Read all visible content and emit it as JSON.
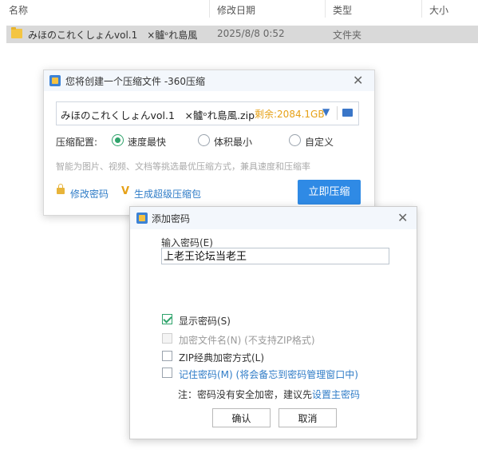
{
  "explorer": {
    "columns": {
      "name": "名称",
      "modified": "修改日期",
      "type": "类型",
      "size": "大小"
    },
    "rows": [
      {
        "name": "みほのこれくしょんvol.1　×髗ᵒれ島風",
        "modified": "2025/8/8 0:52",
        "type": "文件夹"
      }
    ]
  },
  "compress_dialog": {
    "title": "您将创建一个压缩文件 -360压缩",
    "file_name": "みほのこれくしょんvol.1　×髗ᵒれ島風.zip",
    "remaining": "剩余:2084.1GB",
    "config_label": "压缩配置:",
    "options": [
      {
        "label": "速度最快",
        "selected": true
      },
      {
        "label": "体积最小",
        "selected": false
      },
      {
        "label": "自定义",
        "selected": false
      }
    ],
    "hint": "智能为图片、视频、文档等挑选最优压缩方式，兼具速度和压缩率",
    "modify_password": "修改密码",
    "super_compress": "生成超级压缩包",
    "compress_now": "立即压缩"
  },
  "password_dialog": {
    "title": "添加密码",
    "input_label": "输入密码(E)",
    "password_value": "上老王论坛当老王",
    "checkboxes": [
      {
        "label": "显示密码(S)",
        "checked": true,
        "disabled": false,
        "link": false
      },
      {
        "label": "加密文件名(N) (不支持ZIP格式)",
        "checked": false,
        "disabled": true,
        "link": false
      },
      {
        "label": "ZIP经典加密方式(L)",
        "checked": false,
        "disabled": false,
        "link": false
      },
      {
        "label": "记住密码(M) (将会备忘到密码管理窗口中)",
        "checked": false,
        "disabled": false,
        "link": true
      }
    ],
    "note_prefix": "注：密码没有安全加密，建议先",
    "note_link": "设置主密码",
    "ok": "确认",
    "cancel": "取消"
  },
  "colors": {
    "accent": "#2f8ae5",
    "link": "#2f7cc7",
    "check_green": "#2fa36b",
    "warning_orange": "#e6a117"
  }
}
